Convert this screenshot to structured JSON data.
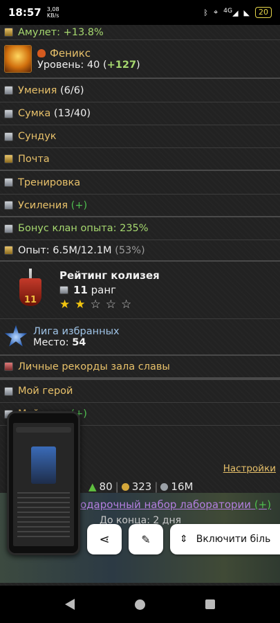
{
  "status": {
    "time": "18:57",
    "speed_value": "3,08",
    "speed_unit": "KB/s",
    "network": "4G",
    "battery": "20"
  },
  "amulet": {
    "label": "Амулет: +13.8%"
  },
  "pet": {
    "name": "Феникс",
    "level_prefix": "Уровень: 40 (",
    "level_bonus": "+127",
    "level_suffix": ")"
  },
  "menu": {
    "skills": {
      "label": "Умения",
      "count": "(6/6)"
    },
    "bag": {
      "label": "Сумка",
      "count": "(13/40)"
    },
    "chest": {
      "label": "Сундук"
    },
    "mail": {
      "label": "Почта"
    },
    "training": {
      "label": "Тренировка"
    },
    "boosts": {
      "label": "Усиления",
      "extra": "(+)"
    },
    "clan_bonus": {
      "label": "Бонус клан опыта: 235%"
    },
    "experience": {
      "label": "Опыт: 6.5M/12.1M",
      "percent": "(53%)"
    }
  },
  "colosseum": {
    "title": "Рейтинг колизея",
    "rank_number": "11",
    "rank_word": "ранг",
    "badge_number": "11",
    "stars_filled": 2,
    "stars_total": 5
  },
  "league": {
    "title": "Лига избранных",
    "place_label": "Место:",
    "place_value": "54"
  },
  "hall_of_fame": {
    "label": "Личные рекорды зала славы"
  },
  "my_hero": {
    "label": "Мой герой"
  },
  "my_clan": {
    "label": "Мой клан",
    "extra": "(+)"
  },
  "settings": {
    "label": "Настройки"
  },
  "resources": {
    "level": "80",
    "gold": "323",
    "silver": "16M"
  },
  "offer": {
    "label": "одарочный набор лаборатории",
    "extra": "(+)",
    "time": "До конца: 2 дня"
  },
  "actions": {
    "enable_label": "Включити біль"
  }
}
